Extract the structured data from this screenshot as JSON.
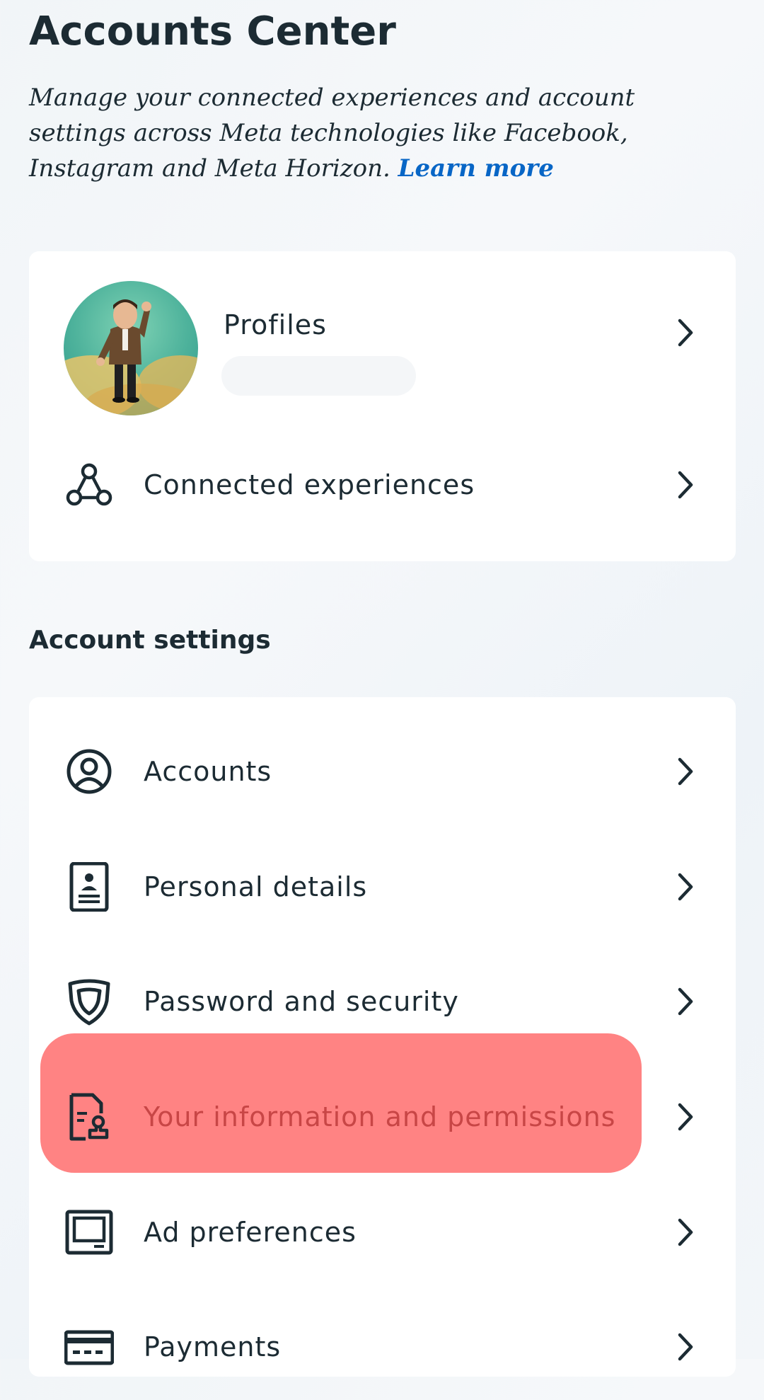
{
  "header": {
    "title": "Accounts Center",
    "description_lines": [
      "Manage your connected experiences and account",
      "settings across Meta technologies like Facebook,",
      "Instagram and Meta Horizon."
    ],
    "learn_more": "Learn more"
  },
  "top_card": {
    "profiles_label": "Profiles",
    "connected_label": "Connected experiences"
  },
  "account_settings": {
    "title": "Account settings",
    "items": [
      {
        "label": "Accounts",
        "icon": "person-circle-icon"
      },
      {
        "label": "Personal details",
        "icon": "id-card-icon"
      },
      {
        "label": "Password and security",
        "icon": "shield-icon"
      },
      {
        "label": "Your information and permissions",
        "icon": "document-stamp-icon"
      },
      {
        "label": "Ad preferences",
        "icon": "monitor-icon"
      },
      {
        "label": "Payments",
        "icon": "credit-card-icon"
      }
    ]
  },
  "colors": {
    "text": "#1c2b33",
    "link": "#0866c6",
    "highlight": "#ff7f7f",
    "highlight_text": "#c84646",
    "card": "#ffffff"
  }
}
